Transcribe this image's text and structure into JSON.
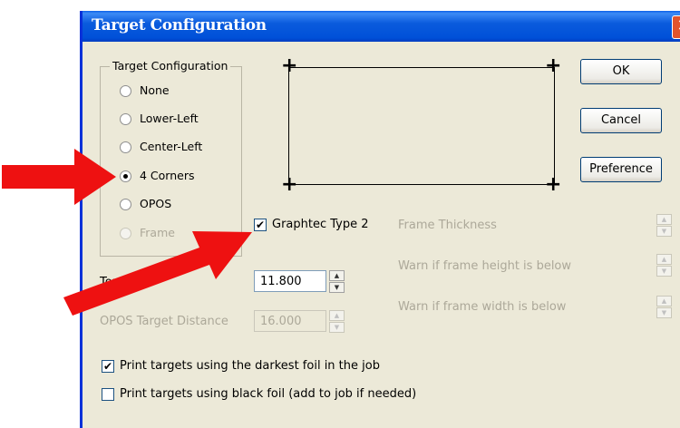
{
  "window": {
    "title": "Target Configuration",
    "close_symbol": "✕"
  },
  "group": {
    "label": "Target Configuration",
    "options": [
      {
        "label": "None",
        "selected": false,
        "enabled": true
      },
      {
        "label": "Lower-Left",
        "selected": false,
        "enabled": true
      },
      {
        "label": "Center-Left",
        "selected": false,
        "enabled": true
      },
      {
        "label": "4 Corners",
        "selected": true,
        "enabled": true
      },
      {
        "label": "OPOS",
        "selected": false,
        "enabled": true
      },
      {
        "label": "Frame",
        "selected": false,
        "enabled": false
      }
    ]
  },
  "buttons": {
    "ok": "OK",
    "cancel": "Cancel",
    "preference": "Preference"
  },
  "graphtec": {
    "label": "Graphtec Type 2",
    "checked": true
  },
  "frame": {
    "thickness_label": "Frame Thickness",
    "height_warn_label": "Warn if frame height is below",
    "width_warn_label": "Warn if frame width is below"
  },
  "top_limit": {
    "label": "Top Limit",
    "value": "11.800"
  },
  "opos_distance": {
    "label": "OPOS Target Distance",
    "value": "16.000"
  },
  "print_darkest": {
    "label": "Print targets using the darkest foil in the job",
    "checked": true
  },
  "print_black": {
    "label": "Print targets using black foil (add to job if needed)",
    "checked": false
  },
  "glyphs": {
    "check": "✔",
    "plus": "+",
    "spin_up": "▲",
    "spin_down": "▼"
  },
  "colors": {
    "annotation_arrow": "#ee1111",
    "titlebar": "#0a5bdd"
  }
}
